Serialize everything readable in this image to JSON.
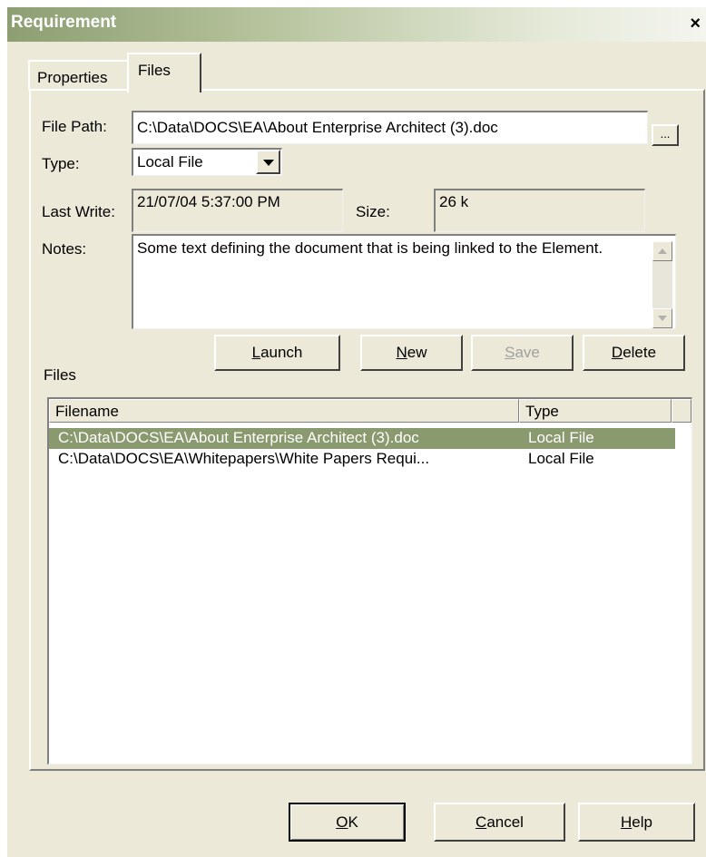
{
  "window": {
    "title": "Requirement",
    "close_glyph": "×"
  },
  "tabs": [
    {
      "label": "Properties"
    },
    {
      "label": "Files"
    }
  ],
  "form": {
    "file_path_label": "File Path:",
    "file_path_value": "C:\\Data\\DOCS\\EA\\About Enterprise Architect (3).doc",
    "browse_label": "...",
    "type_label": "Type:",
    "type_value": "Local File",
    "last_write_label": "Last Write:",
    "last_write_value": "21/07/04 5:37:00 PM",
    "size_label": "Size:",
    "size_value": "26 k",
    "notes_label": "Notes:",
    "notes_value": "Some text defining the document that is being linked to the Element."
  },
  "actions": {
    "launch": {
      "mnemonic": "L",
      "rest": "aunch"
    },
    "new": {
      "mnemonic": "N",
      "rest": "ew"
    },
    "save": {
      "mnemonic": "S",
      "rest": "ave"
    },
    "delete": {
      "mnemonic": "D",
      "rest": "elete"
    }
  },
  "files_section_label": "Files",
  "files_table": {
    "columns": [
      "Filename",
      "Type"
    ],
    "rows": [
      {
        "filename": "C:\\Data\\DOCS\\EA\\About Enterprise Architect (3).doc",
        "type": "Local File",
        "selected": true
      },
      {
        "filename": "C:\\Data\\DOCS\\EA\\Whitepapers\\White Papers Requi...",
        "type": "Local File",
        "selected": false
      }
    ]
  },
  "footer": {
    "ok": {
      "mnemonic": "O",
      "rest": "K"
    },
    "cancel": {
      "mnemonic": "C",
      "rest": "ancel"
    },
    "help": {
      "mnemonic": "H",
      "rest": "elp"
    }
  },
  "colors": {
    "selection": "#8a9a6f",
    "face": "#ece9d8",
    "title_start": "#8c9e72"
  }
}
